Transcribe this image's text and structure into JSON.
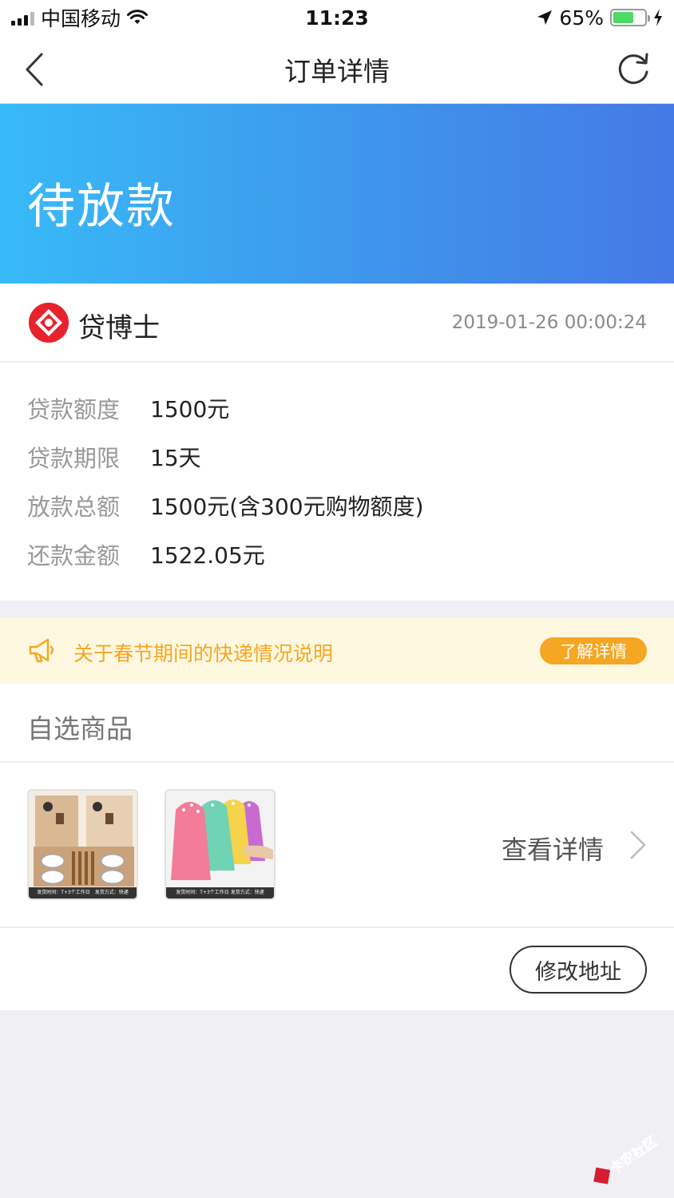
{
  "status_bar": {
    "carrier": "中国移动",
    "time": "11:23",
    "battery": "65%",
    "battery_level": 0.65
  },
  "nav": {
    "title": "订单详情",
    "back_icon": "chevron-left-icon",
    "refresh_icon": "refresh-icon"
  },
  "order": {
    "status": "待放款",
    "merchant_name": "贷博士",
    "order_time": "2019-01-26 00:00:24"
  },
  "details": [
    {
      "label": "贷款额度",
      "value": "1500元"
    },
    {
      "label": "贷款期限",
      "value": "15天"
    },
    {
      "label": "放款总额",
      "value": "1500元(含300元购物额度)"
    },
    {
      "label": "还款金额",
      "value": "1522.05元"
    }
  ],
  "notice": {
    "icon": "megaphone-icon",
    "text": "关于春节期间的快递情况说明",
    "button_label": "了解详情"
  },
  "goods": {
    "title": "自选商品",
    "items": [
      {
        "name": "tableware-set",
        "caption": "发货时间：T+3个工作日　发货方式：快递"
      },
      {
        "name": "hand-towel",
        "caption": "发货时间：T+3个工作日 发货方式：快递"
      }
    ],
    "view_detail_label": "查看详情"
  },
  "address": {
    "button_label": "修改地址"
  },
  "watermark": {
    "text": "卡农社区"
  },
  "colors": {
    "banner_start": "#38baf8",
    "banner_end": "#4579e6",
    "notice_bg": "#fff8e1",
    "notice_accent": "#f5a623",
    "logo_red": "#e8222c"
  }
}
